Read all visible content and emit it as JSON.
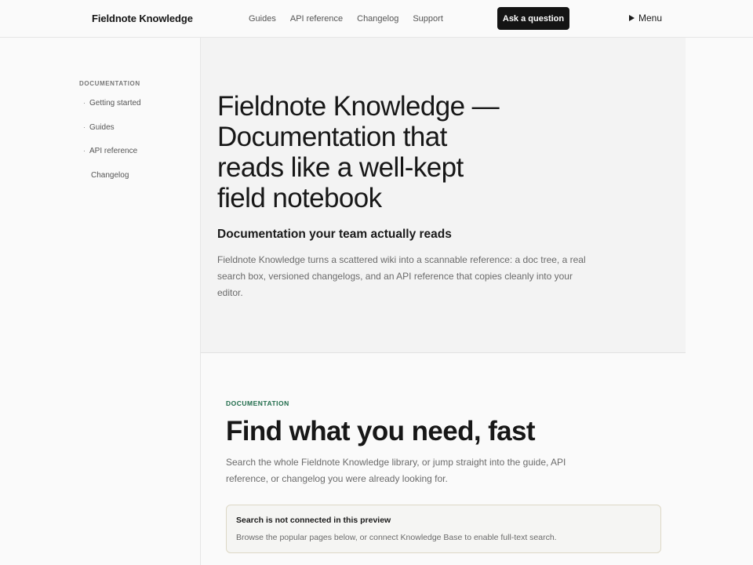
{
  "header": {
    "brand": "Fieldnote Knowledge",
    "nav": [
      "Guides",
      "API reference",
      "Changelog",
      "Support"
    ],
    "cta_label": "Ask a question",
    "menu_label": "Menu"
  },
  "sidebar": {
    "heading": "DOCUMENTATION",
    "items": [
      {
        "label": "Getting started",
        "bullet": "·"
      },
      {
        "label": "Guides",
        "bullet": "·"
      },
      {
        "label": "API reference",
        "bullet": "·"
      },
      {
        "label": "Changelog",
        "bullet": ""
      }
    ]
  },
  "hero": {
    "title": "Fieldnote Knowledge — Documentation that reads like a well-kept field notebook",
    "subtitle": "Documentation your team actually reads",
    "description": "Fieldnote Knowledge turns a scattered wiki into a scannable reference: a doc tree, a real search box, versioned changelogs, and an API reference that copies cleanly into your editor."
  },
  "docs": {
    "eyebrow": "DOCUMENTATION",
    "title": "Find what you need, fast",
    "description": "Search the whole Fieldnote Knowledge library, or jump straight into the guide, API reference, or changelog you were already looking for.",
    "notice": {
      "title": "Search is not connected in this preview",
      "body": "Browse the popular pages below, or connect Knowledge Base to enable full-text search."
    }
  },
  "colors": {
    "accent": "#1f6b4a",
    "button_bg": "#141414",
    "notice_border": "#ddd8c6"
  }
}
